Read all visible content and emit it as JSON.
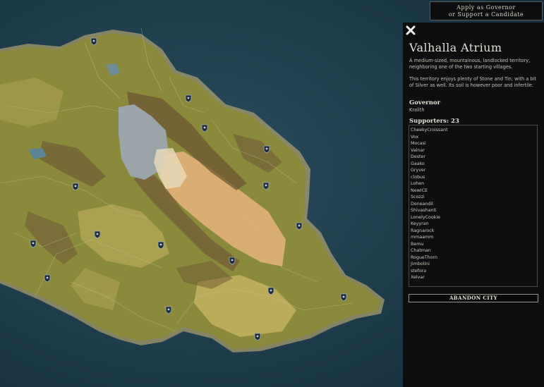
{
  "header": {
    "apply_line1": "Apply as Governor",
    "apply_line2": "or Support a Candidate"
  },
  "panel": {
    "title": "Valhalla Atrium",
    "description1": "A medium-sized, mountainous, landlocked territory, neighboring one of the two starting villages.",
    "description2": "This territory enjoys plenty of Stone and Tin, with a bit of Silver as well. Its soil is however poor and infertile.",
    "governor_label": "Governor",
    "governor_name": "Kralith",
    "supporters_label": "Supporters: 23",
    "supporters": [
      "CheekyCroissant",
      "Vox",
      "Mocasi",
      "Valnar",
      "Dester",
      "Gaako",
      "Gryver",
      "clobus",
      "Lohen",
      "NewICE",
      "Scozzi",
      "Deneandil",
      "Shivashanti",
      "LonelyCookie",
      "Keyyran",
      "Ragnarock",
      "mmaamm",
      "Bemu",
      "Chatman",
      "RogueThorn",
      "Jimbolini",
      "stefora",
      "Xelvar"
    ],
    "abandon_label": "ABANDON CITY"
  },
  "icons": {
    "close": "close-icon",
    "marker": "shield-marker-icon"
  },
  "colors": {
    "sea": "#1d3a4c",
    "land": "#8f8a3a",
    "plains": "#c9a85a",
    "desert": "#dcb27a",
    "mountain": "#6b5431",
    "lake": "#9aa3a8",
    "panel_bg": "#0d0e10"
  }
}
